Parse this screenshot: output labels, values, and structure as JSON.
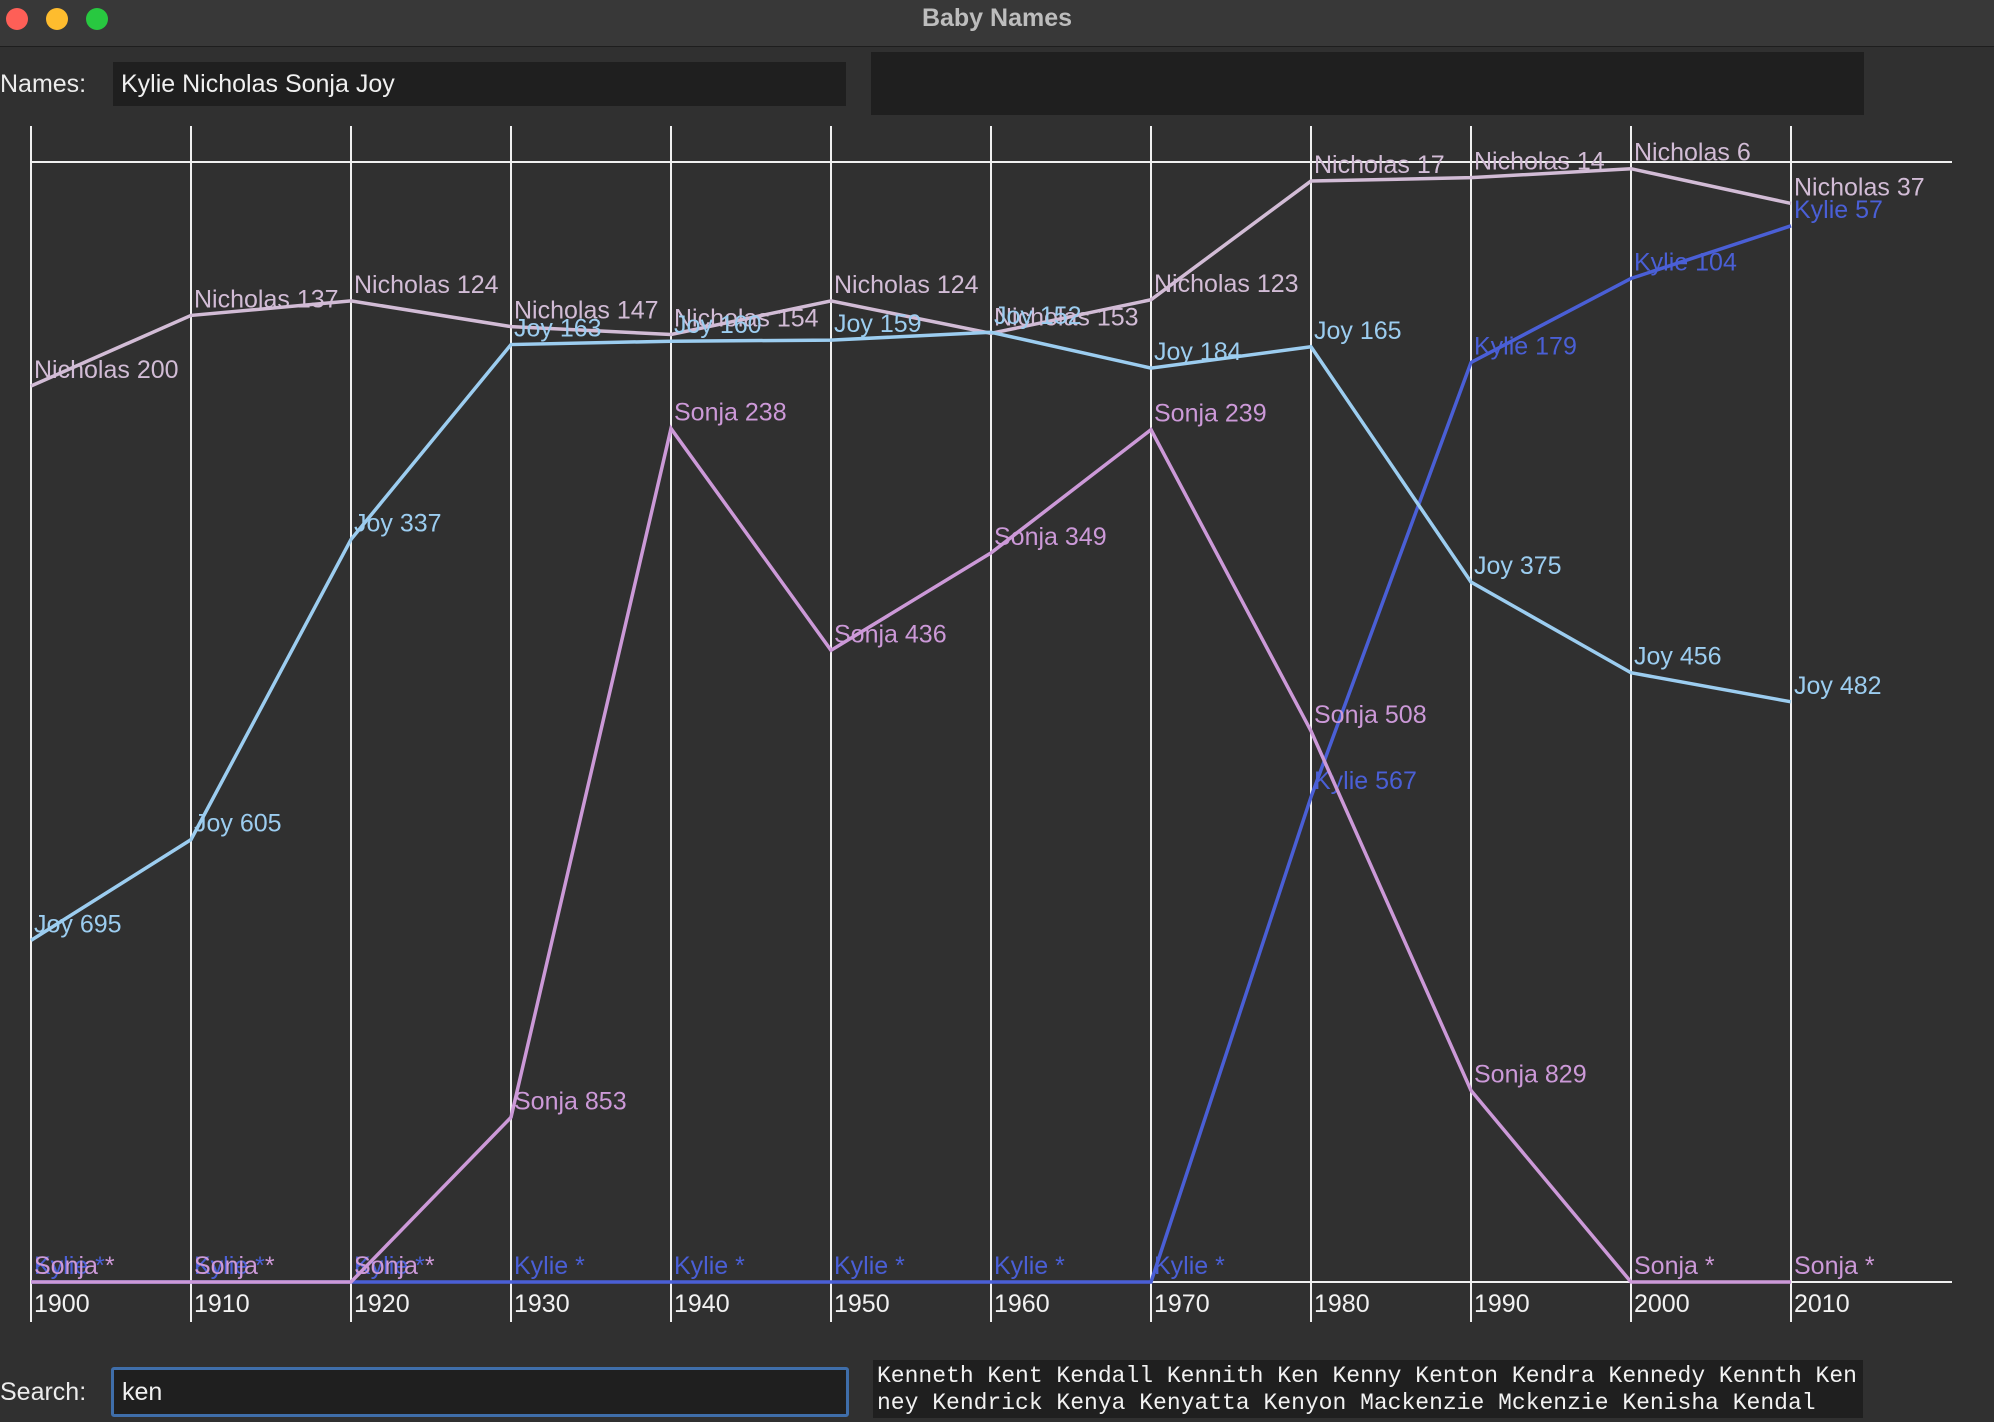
{
  "window": {
    "title": "Baby Names",
    "controls": [
      "close",
      "minimize",
      "zoom"
    ]
  },
  "names": {
    "label": "Names:",
    "value": "Kylie Nicholas Sonja Joy"
  },
  "search": {
    "label": "Search:",
    "value": "ken",
    "suggestions": "Kenneth Kent Kendall Kennith Ken Kenny Kenton Kendra Kennedy Kennth Kenney Kendrick Kenya Kenyatta Kenyon Mackenzie Mckenzie Kenisha Kendal"
  },
  "chart_data": {
    "type": "line",
    "x": [
      1900,
      1910,
      1920,
      1930,
      1940,
      1950,
      1960,
      1970,
      1980,
      1990,
      2000,
      2010
    ],
    "tick_labels": [
      "1900",
      "1910",
      "1920",
      "1930",
      "1940",
      "1950",
      "1960",
      "1970",
      "1980",
      "1990",
      "2000",
      "2010"
    ],
    "ylim": [
      1,
      1000
    ],
    "y_inverted": true,
    "zero_meaning": "*",
    "grid": true,
    "series": [
      {
        "name": "Kylie",
        "color": "#4a5fd6",
        "values": [
          0,
          0,
          0,
          0,
          0,
          0,
          0,
          0,
          567,
          179,
          104,
          57
        ],
        "labels": [
          "Kylie *",
          "Kylie *",
          "Kylie *",
          "Kylie *",
          "Kylie *",
          "Kylie *",
          "Kylie *",
          "Kylie *",
          "Kylie 567",
          "Kylie 179",
          "Kylie 104",
          "Kylie 57"
        ]
      },
      {
        "name": "Nicholas",
        "color": "#d2bcd6",
        "values": [
          200,
          137,
          124,
          147,
          154,
          124,
          153,
          123,
          17,
          14,
          6,
          37
        ],
        "labels": [
          "Nicholas 200",
          "Nicholas 137",
          "Nicholas 124",
          "Nicholas 147",
          "Nicholas 154",
          "Nicholas 124",
          "Nicholas 153",
          "Nicholas 123",
          "Nicholas 17",
          "Nicholas 14",
          "Nicholas 6",
          "Nicholas 37"
        ]
      },
      {
        "name": "Sonja",
        "color": "#cc99d8",
        "values": [
          0,
          0,
          0,
          853,
          238,
          436,
          349,
          239,
          508,
          829,
          0,
          0
        ],
        "labels": [
          "Sonja *",
          "Sonja *",
          "Sonja *",
          "Sonja 853",
          "Sonja 238",
          "Sonja 436",
          "Sonja 349",
          "Sonja 239",
          "Sonja 508",
          "Sonja 829",
          "Sonja *",
          "Sonja *"
        ]
      },
      {
        "name": "Joy",
        "color": "#9ccdf0",
        "values": [
          695,
          605,
          337,
          163,
          160,
          159,
          152,
          184,
          165,
          375,
          456,
          482
        ],
        "labels": [
          "Joy 695",
          "Joy 605",
          "Joy 337",
          "Joy 163",
          "Joy 160",
          "Joy 159",
          "Joy 152",
          "Joy 184",
          "Joy 165",
          "Joy 375",
          "Joy 456",
          "Joy 482"
        ]
      }
    ]
  }
}
